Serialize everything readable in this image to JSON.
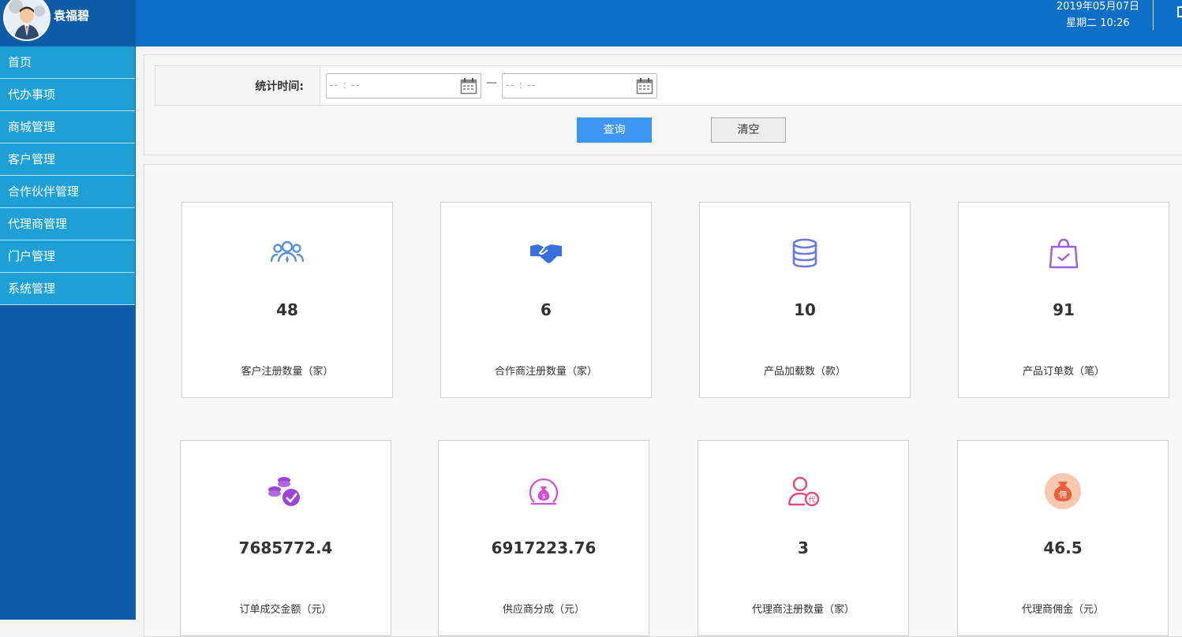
{
  "user": {
    "name": "袁福碧"
  },
  "nav": {
    "items": [
      "首页",
      "代办事项",
      "商城管理",
      "客户管理",
      "合作伙伴管理",
      "代理商管理",
      "门户管理",
      "系统管理"
    ]
  },
  "header": {
    "date": "2019年05月07日",
    "weekday_time": "星期二 10:26"
  },
  "filter": {
    "label": "统计时间:",
    "start_placeholder": "-- : --",
    "end_placeholder": "-- : --",
    "separator": "—",
    "query_label": "查询",
    "clear_label": "清空"
  },
  "stats": [
    {
      "value": "48",
      "label": "客户注册数量（家）",
      "icon": "users-icon",
      "color": "#5b8fd8"
    },
    {
      "value": "6",
      "label": "合作商注册数量（家）",
      "icon": "handshake-icon",
      "color": "#3a6fe0"
    },
    {
      "value": "10",
      "label": "产品加载数（款）",
      "icon": "database-icon",
      "color": "#6a78e0"
    },
    {
      "value": "91",
      "label": "产品订单数（笔）",
      "icon": "shopping-bag-icon",
      "color": "#9b5de5"
    },
    {
      "value": "7685772.4",
      "label": "订单成交金额（元）",
      "icon": "coins-check-icon",
      "color": "#9c45d6"
    },
    {
      "value": "6917223.76",
      "label": "供应商分成（元）",
      "icon": "money-bag-icon",
      "color": "#d34fd6"
    },
    {
      "value": "3",
      "label": "代理商注册数量（家）",
      "icon": "agent-user-icon",
      "color": "#e24b7a"
    },
    {
      "value": "46.5",
      "label": "代理商佣金（元）",
      "icon": "commission-icon",
      "color": "#e8603c"
    }
  ]
}
